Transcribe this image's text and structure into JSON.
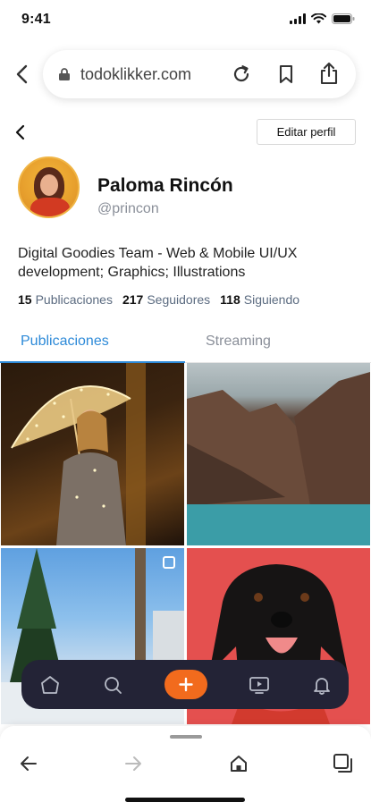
{
  "status_bar": {
    "time": "9:41"
  },
  "browser": {
    "url": "todoklikker.com"
  },
  "profile": {
    "edit_label": "Editar perfil",
    "name": "Paloma Rincón",
    "handle": "@princon",
    "bio": "Digital Goodies Team - Web & Mobile UI/UX development; Graphics; Illustrations",
    "stats": [
      {
        "value": "15",
        "label": "Publicaciones"
      },
      {
        "value": "217",
        "label": "Seguidores"
      },
      {
        "value": "118",
        "label": "Siguiendo"
      }
    ]
  },
  "tabs": [
    {
      "label": "Publicaciones",
      "active": true
    },
    {
      "label": "Streaming",
      "active": false
    }
  ],
  "colors": {
    "accent": "#2d8ad8",
    "nav_background": "#232336",
    "add_button": "#f26b1d"
  },
  "icons": {
    "status": [
      "signal-icon",
      "wifi-icon",
      "battery-icon"
    ],
    "url_bar": [
      "back-icon",
      "lock-icon",
      "reload-icon",
      "bookmark-icon",
      "share-icon"
    ],
    "app_nav": [
      "home-icon",
      "search-icon",
      "add-icon",
      "video-icon",
      "notifications-icon"
    ],
    "browser_bar": [
      "back-arrow-icon",
      "forward-arrow-icon",
      "home-icon",
      "tabs-icon"
    ]
  }
}
